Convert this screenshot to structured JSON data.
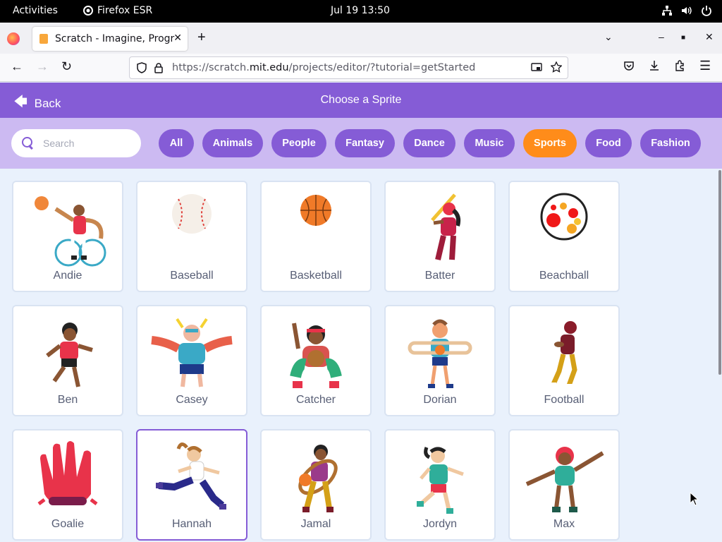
{
  "system": {
    "activities": "Activities",
    "app_name": "Firefox ESR",
    "clock": "Jul 19  13:50"
  },
  "browser": {
    "tab_title": "Scratch - Imagine, Program, Share",
    "url_prefix": "https://scratch.",
    "url_domain": "mit.edu",
    "url_path": "/projects/editor/?tutorial=getStarted"
  },
  "header": {
    "back_label": "Back",
    "title": "Choose a Sprite"
  },
  "search": {
    "placeholder": "Search"
  },
  "filters": [
    "All",
    "Animals",
    "People",
    "Fantasy",
    "Dance",
    "Music",
    "Sports",
    "Food",
    "Fashion"
  ],
  "active_filter": "Sports",
  "sprites": [
    {
      "name": "Andie",
      "icon": "wheelchair-player"
    },
    {
      "name": "Baseball",
      "icon": "baseball"
    },
    {
      "name": "Basketball",
      "icon": "basketball"
    },
    {
      "name": "Batter",
      "icon": "batter"
    },
    {
      "name": "Beachball",
      "icon": "beachball"
    },
    {
      "name": "Ben",
      "icon": "runner-boy"
    },
    {
      "name": "Casey",
      "icon": "casey-player"
    },
    {
      "name": "Catcher",
      "icon": "catcher"
    },
    {
      "name": "Dorian",
      "icon": "hoop-boy"
    },
    {
      "name": "Football",
      "icon": "football-player"
    },
    {
      "name": "Goalie",
      "icon": "goalie-glove"
    },
    {
      "name": "Hannah",
      "icon": "runner-girl"
    },
    {
      "name": "Jamal",
      "icon": "hoop-player"
    },
    {
      "name": "Jordyn",
      "icon": "soccer-girl"
    },
    {
      "name": "Max",
      "icon": "dancing-player"
    }
  ],
  "selected_sprite": "Hannah",
  "colors": {
    "header": "#855cd6",
    "filterbar": "#ccbaf2",
    "active_pill": "#ff8c1a",
    "background": "#e9f1fc"
  }
}
